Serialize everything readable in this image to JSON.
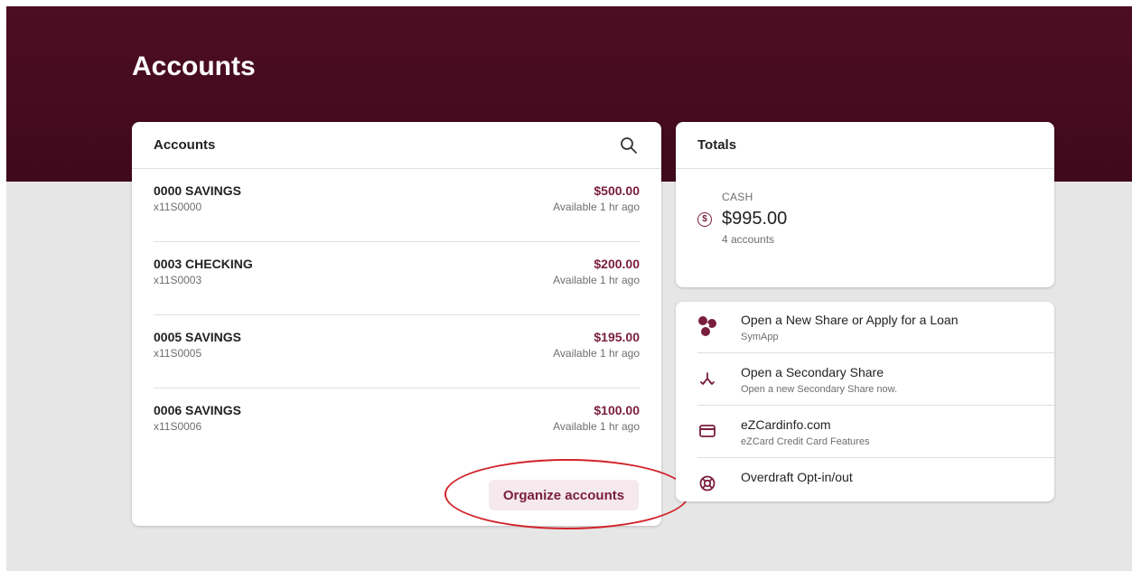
{
  "page": {
    "title": "Accounts"
  },
  "accounts_card": {
    "title": "Accounts",
    "search_icon": "search-icon",
    "accounts": [
      {
        "name": "0000 SAVINGS",
        "number": "x11S0000",
        "balance": "$500.00",
        "availability": "Available 1 hr ago"
      },
      {
        "name": "0003 CHECKING",
        "number": "x11S0003",
        "balance": "$200.00",
        "availability": "Available 1 hr ago"
      },
      {
        "name": "0005 SAVINGS",
        "number": "x11S0005",
        "balance": "$195.00",
        "availability": "Available 1 hr ago"
      },
      {
        "name": "0006 SAVINGS",
        "number": "x11S0006",
        "balance": "$100.00",
        "availability": "Available 1 hr ago"
      }
    ],
    "organize_label": "Organize accounts"
  },
  "totals_card": {
    "title": "Totals",
    "cash_label": "CASH",
    "cash_value": "$995.00",
    "cash_count": "4 accounts",
    "icon": "dollar-circle-icon"
  },
  "quick_links": [
    {
      "title": "Open a New Share or Apply for a Loan",
      "subtitle": "SymApp",
      "icon": "symapp-logo-icon"
    },
    {
      "title": "Open a Secondary Share",
      "subtitle": "Open a new Secondary Share now.",
      "icon": "split-arrow-icon"
    },
    {
      "title": "eZCardinfo.com",
      "subtitle": "eZCard Credit Card Features",
      "icon": "credit-card-icon"
    },
    {
      "title": "Overdraft Opt-in/out",
      "subtitle": "",
      "icon": "lifebuoy-icon"
    }
  ],
  "colors": {
    "brand": "#4d0d22",
    "accent": "#7a1e3e",
    "annotation": "#d2232a"
  }
}
